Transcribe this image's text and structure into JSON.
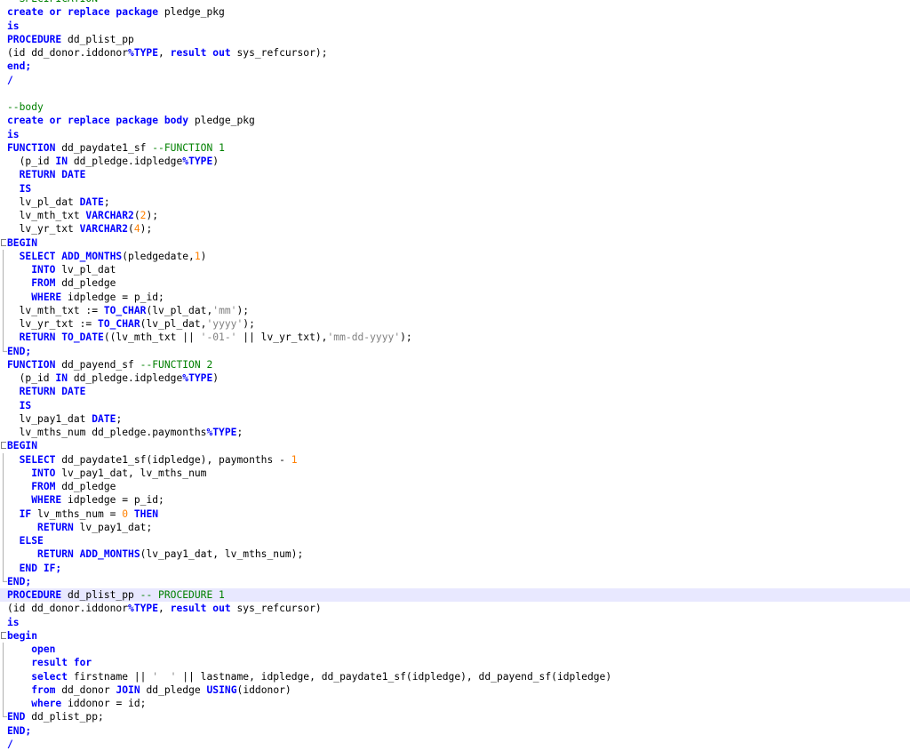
{
  "editor": {
    "language": "PL/SQL",
    "highlighted_line_index": 44,
    "colors": {
      "keyword": "#0000ff",
      "comment": "#008000",
      "number": "#ff8000",
      "string": "#808080",
      "text": "#000000",
      "current_line": "#e8e8ff"
    },
    "lines": [
      {
        "fold": "",
        "tokens": [
          {
            "t": "--SPECIFICATION--",
            "c": "c"
          }
        ]
      },
      {
        "fold": "",
        "tokens": [
          {
            "t": "create or replace package",
            "c": "k"
          },
          {
            "t": " pledge_pkg",
            "c": "t"
          }
        ]
      },
      {
        "fold": "",
        "tokens": [
          {
            "t": "is",
            "c": "k"
          }
        ]
      },
      {
        "fold": "",
        "tokens": [
          {
            "t": "PROCEDURE",
            "c": "k"
          },
          {
            "t": " dd_plist_pp",
            "c": "t"
          }
        ]
      },
      {
        "fold": "",
        "tokens": [
          {
            "t": "(id dd_donor.iddonor",
            "c": "t"
          },
          {
            "t": "%TYPE",
            "c": "k"
          },
          {
            "t": ", ",
            "c": "t"
          },
          {
            "t": "result out",
            "c": "k"
          },
          {
            "t": " sys_refcursor);",
            "c": "t"
          }
        ]
      },
      {
        "fold": "",
        "tokens": [
          {
            "t": "end;",
            "c": "k"
          }
        ]
      },
      {
        "fold": "",
        "tokens": [
          {
            "t": "/",
            "c": "k"
          }
        ]
      },
      {
        "fold": "",
        "tokens": []
      },
      {
        "fold": "",
        "tokens": [
          {
            "t": "--body",
            "c": "c"
          }
        ]
      },
      {
        "fold": "",
        "tokens": [
          {
            "t": "create or replace package body",
            "c": "k"
          },
          {
            "t": " pledge_pkg",
            "c": "t"
          }
        ]
      },
      {
        "fold": "",
        "tokens": [
          {
            "t": "is",
            "c": "k"
          }
        ]
      },
      {
        "fold": "",
        "tokens": [
          {
            "t": "FUNCTION",
            "c": "k"
          },
          {
            "t": " dd_paydate1_sf ",
            "c": "t"
          },
          {
            "t": "--FUNCTION 1",
            "c": "c"
          }
        ]
      },
      {
        "fold": "",
        "tokens": [
          {
            "t": "  (p_id ",
            "c": "t"
          },
          {
            "t": "IN",
            "c": "k"
          },
          {
            "t": " dd_pledge.idpledge",
            "c": "t"
          },
          {
            "t": "%TYPE",
            "c": "k"
          },
          {
            "t": ")",
            "c": "t"
          }
        ]
      },
      {
        "fold": "",
        "tokens": [
          {
            "t": "  ",
            "c": "t"
          },
          {
            "t": "RETURN DATE",
            "c": "k"
          }
        ]
      },
      {
        "fold": "",
        "tokens": [
          {
            "t": "  ",
            "c": "t"
          },
          {
            "t": "IS",
            "c": "k"
          }
        ]
      },
      {
        "fold": "",
        "tokens": [
          {
            "t": "  lv_pl_dat ",
            "c": "t"
          },
          {
            "t": "DATE",
            "c": "k"
          },
          {
            "t": ";",
            "c": "t"
          }
        ]
      },
      {
        "fold": "",
        "tokens": [
          {
            "t": "  lv_mth_txt ",
            "c": "t"
          },
          {
            "t": "VARCHAR2",
            "c": "k"
          },
          {
            "t": "(",
            "c": "t"
          },
          {
            "t": "2",
            "c": "n"
          },
          {
            "t": ");",
            "c": "t"
          }
        ]
      },
      {
        "fold": "",
        "tokens": [
          {
            "t": "  lv_yr_txt ",
            "c": "t"
          },
          {
            "t": "VARCHAR2",
            "c": "k"
          },
          {
            "t": "(",
            "c": "t"
          },
          {
            "t": "4",
            "c": "n"
          },
          {
            "t": ");",
            "c": "t"
          }
        ]
      },
      {
        "fold": "start",
        "tokens": [
          {
            "t": "BEGIN",
            "c": "k"
          }
        ]
      },
      {
        "fold": "mid",
        "tokens": [
          {
            "t": "  ",
            "c": "t"
          },
          {
            "t": "SELECT ADD_MONTHS",
            "c": "k"
          },
          {
            "t": "(pledgedate,",
            "c": "t"
          },
          {
            "t": "1",
            "c": "n"
          },
          {
            "t": ")",
            "c": "t"
          }
        ]
      },
      {
        "fold": "mid",
        "tokens": [
          {
            "t": "    ",
            "c": "t"
          },
          {
            "t": "INTO",
            "c": "k"
          },
          {
            "t": " lv_pl_dat",
            "c": "t"
          }
        ]
      },
      {
        "fold": "mid",
        "tokens": [
          {
            "t": "    ",
            "c": "t"
          },
          {
            "t": "FROM",
            "c": "k"
          },
          {
            "t": " dd_pledge",
            "c": "t"
          }
        ]
      },
      {
        "fold": "mid",
        "tokens": [
          {
            "t": "    ",
            "c": "t"
          },
          {
            "t": "WHERE",
            "c": "k"
          },
          {
            "t": " idpledge = p_id;",
            "c": "t"
          }
        ]
      },
      {
        "fold": "mid",
        "tokens": [
          {
            "t": "  lv_mth_txt := ",
            "c": "t"
          },
          {
            "t": "TO_CHAR",
            "c": "k"
          },
          {
            "t": "(lv_pl_dat,",
            "c": "t"
          },
          {
            "t": "'mm'",
            "c": "s"
          },
          {
            "t": ");",
            "c": "t"
          }
        ]
      },
      {
        "fold": "mid",
        "tokens": [
          {
            "t": "  lv_yr_txt := ",
            "c": "t"
          },
          {
            "t": "TO_CHAR",
            "c": "k"
          },
          {
            "t": "(lv_pl_dat,",
            "c": "t"
          },
          {
            "t": "'yyyy'",
            "c": "s"
          },
          {
            "t": ");",
            "c": "t"
          }
        ]
      },
      {
        "fold": "mid",
        "tokens": [
          {
            "t": "  ",
            "c": "t"
          },
          {
            "t": "RETURN TO_DATE",
            "c": "k"
          },
          {
            "t": "((lv_mth_txt || ",
            "c": "t"
          },
          {
            "t": "'-01-'",
            "c": "s"
          },
          {
            "t": " || lv_yr_txt),",
            "c": "t"
          },
          {
            "t": "'mm-dd-yyyy'",
            "c": "s"
          },
          {
            "t": ");",
            "c": "t"
          }
        ]
      },
      {
        "fold": "end",
        "tokens": [
          {
            "t": "END;",
            "c": "k"
          }
        ]
      },
      {
        "fold": "",
        "tokens": [
          {
            "t": "FUNCTION",
            "c": "k"
          },
          {
            "t": " dd_payend_sf ",
            "c": "t"
          },
          {
            "t": "--FUNCTION 2",
            "c": "c"
          }
        ]
      },
      {
        "fold": "",
        "tokens": [
          {
            "t": "  (p_id ",
            "c": "t"
          },
          {
            "t": "IN",
            "c": "k"
          },
          {
            "t": " dd_pledge.idpledge",
            "c": "t"
          },
          {
            "t": "%TYPE",
            "c": "k"
          },
          {
            "t": ")",
            "c": "t"
          }
        ]
      },
      {
        "fold": "",
        "tokens": [
          {
            "t": "  ",
            "c": "t"
          },
          {
            "t": "RETURN DATE",
            "c": "k"
          }
        ]
      },
      {
        "fold": "",
        "tokens": [
          {
            "t": "  ",
            "c": "t"
          },
          {
            "t": "IS",
            "c": "k"
          }
        ]
      },
      {
        "fold": "",
        "tokens": [
          {
            "t": "  lv_pay1_dat ",
            "c": "t"
          },
          {
            "t": "DATE",
            "c": "k"
          },
          {
            "t": ";",
            "c": "t"
          }
        ]
      },
      {
        "fold": "",
        "tokens": [
          {
            "t": "  lv_mths_num dd_pledge.paymonths",
            "c": "t"
          },
          {
            "t": "%TYPE",
            "c": "k"
          },
          {
            "t": ";",
            "c": "t"
          }
        ]
      },
      {
        "fold": "start",
        "tokens": [
          {
            "t": "BEGIN",
            "c": "k"
          }
        ]
      },
      {
        "fold": "mid",
        "tokens": [
          {
            "t": "  ",
            "c": "t"
          },
          {
            "t": "SELECT",
            "c": "k"
          },
          {
            "t": " dd_paydate1_sf(idpledge), paymonths - ",
            "c": "t"
          },
          {
            "t": "1",
            "c": "n"
          }
        ]
      },
      {
        "fold": "mid",
        "tokens": [
          {
            "t": "    ",
            "c": "t"
          },
          {
            "t": "INTO",
            "c": "k"
          },
          {
            "t": " lv_pay1_dat, lv_mths_num",
            "c": "t"
          }
        ]
      },
      {
        "fold": "mid",
        "tokens": [
          {
            "t": "    ",
            "c": "t"
          },
          {
            "t": "FROM",
            "c": "k"
          },
          {
            "t": " dd_pledge",
            "c": "t"
          }
        ]
      },
      {
        "fold": "mid",
        "tokens": [
          {
            "t": "    ",
            "c": "t"
          },
          {
            "t": "WHERE",
            "c": "k"
          },
          {
            "t": " idpledge = p_id;",
            "c": "t"
          }
        ]
      },
      {
        "fold": "mid",
        "tokens": [
          {
            "t": "  ",
            "c": "t"
          },
          {
            "t": "IF",
            "c": "k"
          },
          {
            "t": " lv_mths_num = ",
            "c": "t"
          },
          {
            "t": "0",
            "c": "n"
          },
          {
            "t": " ",
            "c": "t"
          },
          {
            "t": "THEN",
            "c": "k"
          }
        ]
      },
      {
        "fold": "mid",
        "tokens": [
          {
            "t": "     ",
            "c": "t"
          },
          {
            "t": "RETURN",
            "c": "k"
          },
          {
            "t": " lv_pay1_dat;",
            "c": "t"
          }
        ]
      },
      {
        "fold": "mid",
        "tokens": [
          {
            "t": "  ",
            "c": "t"
          },
          {
            "t": "ELSE",
            "c": "k"
          }
        ]
      },
      {
        "fold": "mid",
        "tokens": [
          {
            "t": "     ",
            "c": "t"
          },
          {
            "t": "RETURN ADD_MONTHS",
            "c": "k"
          },
          {
            "t": "(lv_pay1_dat, lv_mths_num);",
            "c": "t"
          }
        ]
      },
      {
        "fold": "mid",
        "tokens": [
          {
            "t": "  ",
            "c": "t"
          },
          {
            "t": "END IF;",
            "c": "k"
          }
        ]
      },
      {
        "fold": "end",
        "tokens": [
          {
            "t": "END;",
            "c": "k"
          }
        ]
      },
      {
        "fold": "",
        "tokens": [
          {
            "t": "PROCEDURE",
            "c": "k"
          },
          {
            "t": " dd_plist_pp ",
            "c": "t"
          },
          {
            "t": "-- PROCEDURE 1",
            "c": "c"
          }
        ]
      },
      {
        "fold": "",
        "tokens": [
          {
            "t": "(id dd_donor.iddonor",
            "c": "t"
          },
          {
            "t": "%TYPE",
            "c": "k"
          },
          {
            "t": ", ",
            "c": "t"
          },
          {
            "t": "result out",
            "c": "k"
          },
          {
            "t": " sys_refcursor)",
            "c": "t"
          }
        ]
      },
      {
        "fold": "",
        "tokens": [
          {
            "t": "is",
            "c": "k"
          }
        ]
      },
      {
        "fold": "start",
        "tokens": [
          {
            "t": "begin",
            "c": "k"
          }
        ]
      },
      {
        "fold": "mid",
        "tokens": [
          {
            "t": "    ",
            "c": "t"
          },
          {
            "t": "open",
            "c": "k"
          }
        ]
      },
      {
        "fold": "mid",
        "tokens": [
          {
            "t": "    ",
            "c": "t"
          },
          {
            "t": "result for",
            "c": "k"
          }
        ]
      },
      {
        "fold": "mid",
        "tokens": [
          {
            "t": "    ",
            "c": "t"
          },
          {
            "t": "select",
            "c": "k"
          },
          {
            "t": " firstname || ",
            "c": "t"
          },
          {
            "t": "'  '",
            "c": "s"
          },
          {
            "t": " || lastname, idpledge, dd_paydate1_sf(idpledge), dd_payend_sf(idpledge)",
            "c": "t"
          }
        ]
      },
      {
        "fold": "mid",
        "tokens": [
          {
            "t": "    ",
            "c": "t"
          },
          {
            "t": "from",
            "c": "k"
          },
          {
            "t": " dd_donor ",
            "c": "t"
          },
          {
            "t": "JOIN",
            "c": "k"
          },
          {
            "t": " dd_pledge ",
            "c": "t"
          },
          {
            "t": "USING",
            "c": "k"
          },
          {
            "t": "(iddonor)",
            "c": "t"
          }
        ]
      },
      {
        "fold": "mid",
        "tokens": [
          {
            "t": "    ",
            "c": "t"
          },
          {
            "t": "where",
            "c": "k"
          },
          {
            "t": " iddonor = id;",
            "c": "t"
          }
        ]
      },
      {
        "fold": "end",
        "tokens": [
          {
            "t": "END",
            "c": "k"
          },
          {
            "t": " dd_plist_pp;",
            "c": "t"
          }
        ]
      },
      {
        "fold": "",
        "tokens": [
          {
            "t": "END;",
            "c": "k"
          }
        ]
      },
      {
        "fold": "",
        "tokens": [
          {
            "t": "/",
            "c": "k"
          }
        ]
      }
    ]
  }
}
